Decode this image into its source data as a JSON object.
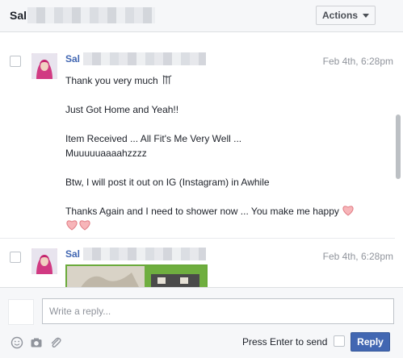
{
  "header": {
    "title": "Sal",
    "actions_label": "Actions"
  },
  "messages": [
    {
      "sender": "Sal",
      "time": "Feb 4th, 6:28pm",
      "lines": [
        "Thank you very much",
        "Just Got Home and Yeah!!",
        "Item Received ... All Fit's Me Very Well ...",
        "Muuuuuaaaahzzzz",
        "Btw, I will post it out on IG (Instagram) in Awhile",
        "Thanks Again and I need to shower now ... You make me happy"
      ]
    },
    {
      "sender": "Sal",
      "time": "Feb 4th, 6:28pm"
    }
  ],
  "composer": {
    "placeholder": "Write a reply...",
    "press_enter_label": "Press Enter to send",
    "reply_label": "Reply"
  },
  "icons": {
    "emoji": "smiley-icon",
    "camera": "camera-icon",
    "attach": "paperclip-icon",
    "heart": "heart-icon",
    "bow": "bow-emoticon-icon"
  },
  "colors": {
    "link_blue": "#4267b2",
    "heart_pink": "#f4a3a8",
    "button_blue": "#4267b2"
  }
}
